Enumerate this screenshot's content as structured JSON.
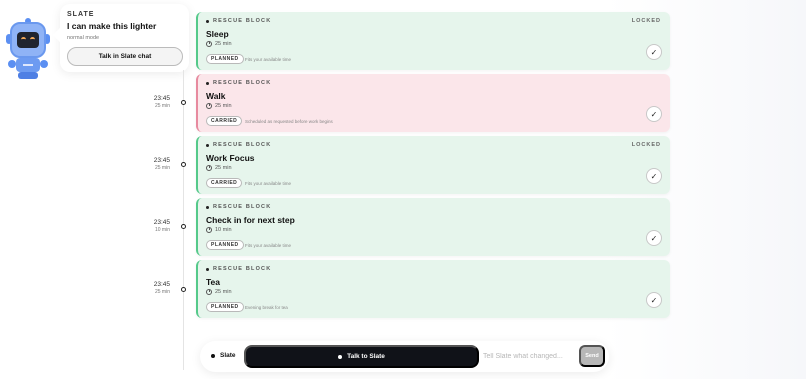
{
  "assistant": {
    "name": "SLATE",
    "message": "I can make this lighter",
    "mode": "normal mode",
    "chat_button": "Talk in Slate chat"
  },
  "blocks": [
    {
      "kind": "RESCUE BLOCK",
      "lock": "LOCKED",
      "title": "Sleep",
      "duration": "25 min",
      "status": "PLANNED",
      "note": "Fits your available time",
      "time": "",
      "time_duration": "",
      "done": true
    },
    {
      "kind": "RESCUE BLOCK",
      "lock": "",
      "title": "Walk",
      "duration": "25 min",
      "status": "CARRIED",
      "note": "Scheduled as requested before work begins",
      "time": "23:45",
      "time_duration": "25 min",
      "done": true
    },
    {
      "kind": "RESCUE BLOCK",
      "lock": "LOCKED",
      "title": "Work Focus",
      "duration": "25 min",
      "status": "CARRIED",
      "note": "Fits your available time",
      "time": "23:45",
      "time_duration": "25 min",
      "done": true
    },
    {
      "kind": "RESCUE BLOCK",
      "lock": "",
      "title": "Check in for next step",
      "duration": "10 min",
      "status": "PLANNED",
      "note": "Fits your available time",
      "time": "23:45",
      "time_duration": "10 min",
      "done": true
    },
    {
      "kind": "RESCUE BLOCK",
      "lock": "",
      "title": "Tea",
      "duration": "25 min",
      "status": "PLANNED",
      "note": "Evening break for tea",
      "time": "23:45",
      "time_duration": "25 min",
      "done": true
    }
  ],
  "bottom_bar": {
    "brand": "Slate",
    "talk_button": "Talk to Slate",
    "input_placeholder": "Tell Slate what changed...",
    "input_value": "",
    "send_button": "Send"
  },
  "colors": {
    "planned_bg": "#e6f5ec",
    "planned_accent": "#55c98a",
    "carried_bg": "#fbe6ea",
    "carried_accent": "#e78a9f",
    "dark": "#101218"
  },
  "icons": {
    "mascot": "robot-mascot-icon",
    "duration": "clock-icon",
    "complete": "checkmark-icon"
  }
}
